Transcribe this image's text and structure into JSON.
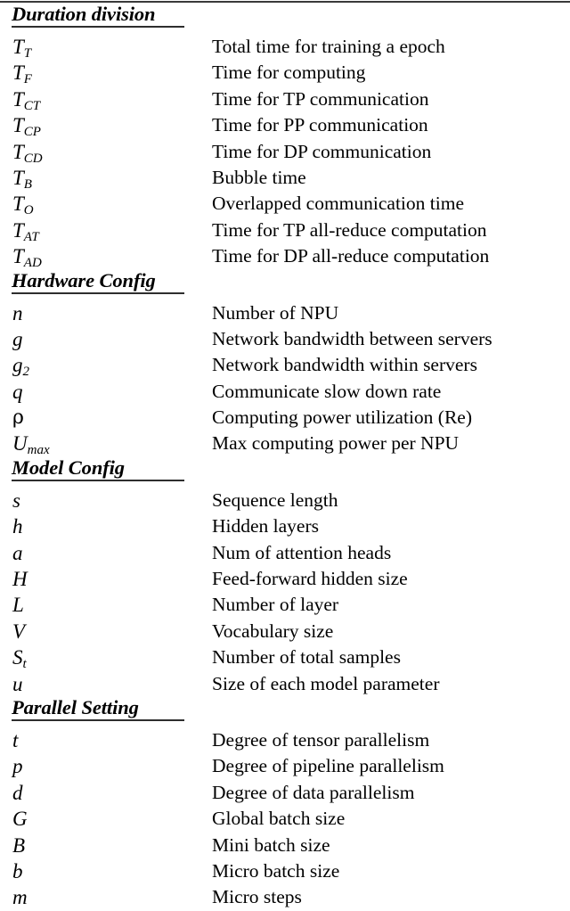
{
  "document": {
    "type": "notation-table",
    "top_rule": true,
    "columns": [
      "symbol",
      "description"
    ]
  },
  "sections": [
    {
      "title": "Duration division",
      "rows": [
        {
          "symbol": "T",
          "subscript": "T",
          "description": "Total time for training a epoch"
        },
        {
          "symbol": "T",
          "subscript": "F",
          "description": "Time for computing"
        },
        {
          "symbol": "T",
          "subscript": "CT",
          "description": "Time for TP communication"
        },
        {
          "symbol": "T",
          "subscript": "CP",
          "description": "Time for PP communication"
        },
        {
          "symbol": "T",
          "subscript": "CD",
          "description": "Time for DP communication"
        },
        {
          "symbol": "T",
          "subscript": "B",
          "description": "Bubble time"
        },
        {
          "symbol": "T",
          "subscript": "O",
          "description": "Overlapped communication time"
        },
        {
          "symbol": "T",
          "subscript": "AT",
          "description": "Time for TP all-reduce computation"
        },
        {
          "symbol": "T",
          "subscript": "AD",
          "description": "Time for DP all-reduce computation"
        }
      ]
    },
    {
      "title": "Hardware Config",
      "rows": [
        {
          "symbol": "n",
          "subscript": "",
          "description": "Number of NPU"
        },
        {
          "symbol": "g",
          "subscript": "",
          "description": "Network bandwidth between servers"
        },
        {
          "symbol": "g",
          "subscript": "2",
          "description": "Network bandwidth within servers"
        },
        {
          "symbol": "q",
          "subscript": "",
          "description": "Communicate slow down rate"
        },
        {
          "symbol": "ρ",
          "subscript": "",
          "description": "Computing power utilization (Re)"
        },
        {
          "symbol": "U",
          "subscript": "max",
          "description": "Max computing power per NPU"
        }
      ]
    },
    {
      "title": "Model Config",
      "rows": [
        {
          "symbol": "s",
          "subscript": "",
          "description": "Sequence length"
        },
        {
          "symbol": "h",
          "subscript": "",
          "description": "Hidden layers"
        },
        {
          "symbol": "a",
          "subscript": "",
          "description": "Num of attention heads"
        },
        {
          "symbol": "H",
          "subscript": "",
          "description": "Feed-forward hidden size"
        },
        {
          "symbol": "L",
          "subscript": "",
          "description": "Number of layer"
        },
        {
          "symbol": "V",
          "subscript": "",
          "description": "Vocabulary size"
        },
        {
          "symbol": "S",
          "subscript": "t",
          "description": "Number of total samples"
        },
        {
          "symbol": "u",
          "subscript": "",
          "description": "Size of each model parameter"
        }
      ]
    },
    {
      "title": "Parallel Setting",
      "rows": [
        {
          "symbol": "t",
          "subscript": "",
          "description": "Degree of tensor parallelism"
        },
        {
          "symbol": "p",
          "subscript": "",
          "description": "Degree of pipeline parallelism"
        },
        {
          "symbol": "d",
          "subscript": "",
          "description": "Degree of data parallelism"
        },
        {
          "symbol": "G",
          "subscript": "",
          "description": "Global batch size"
        },
        {
          "symbol": "B",
          "subscript": "",
          "description": "Mini batch size"
        },
        {
          "symbol": "b",
          "subscript": "",
          "description": "Micro batch size"
        },
        {
          "symbol": "m",
          "subscript": "",
          "description": "Micro steps"
        }
      ]
    }
  ],
  "style": {
    "text_color": "#000000",
    "rule_color": "#2e2e2e",
    "background": "#ffffff"
  }
}
